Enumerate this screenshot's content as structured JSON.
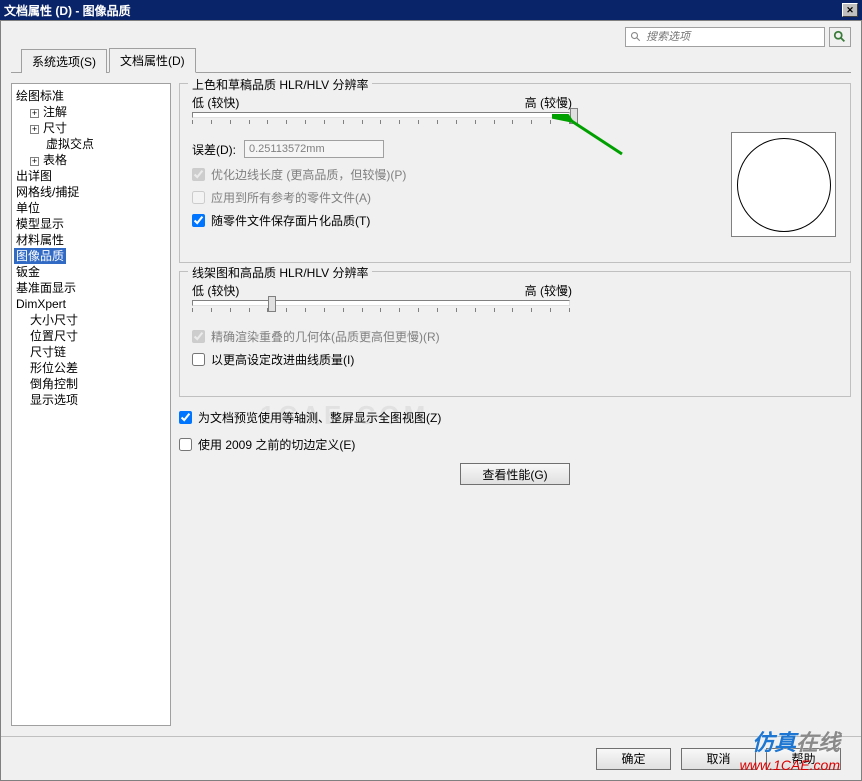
{
  "title": "文档属性 (D) - 图像品质",
  "search": {
    "placeholder": "搜索选项"
  },
  "tabs": {
    "system": "系统选项(S)",
    "document": "文档属性(D)"
  },
  "tree": {
    "root": "绘图标准",
    "annot": "注解",
    "dim": "尺寸",
    "virtual": "虚拟交点",
    "table": "表格",
    "detail": "出详图",
    "grid": "网格线/捕捉",
    "unit": "单位",
    "modeldisp": "模型显示",
    "material": "材料属性",
    "imagequality": "图像品质",
    "sheetmetal": "钣金",
    "datum": "基准面显示",
    "dimxpert": "DimXpert",
    "sizedim": "大小尺寸",
    "posdim": "位置尺寸",
    "chain": "尺寸链",
    "geotol": "形位公差",
    "chamfer": "倒角控制",
    "dispopt": "显示选项"
  },
  "group1": {
    "legend": "上色和草稿品质 HLR/HLV 分辨率",
    "low": "低 (较快)",
    "high": "高 (较慢)",
    "err_label": "误差(D):",
    "err_value": "0.25113572mm",
    "opt_edge": "优化边线长度 (更高品质，但较慢)(P)",
    "apply_all": "应用到所有参考的零件文件(A)",
    "save_tess": "随零件文件保存面片化品质(T)"
  },
  "group2": {
    "legend": "线架图和高品质 HLR/HLV 分辨率",
    "low": "低 (较快)",
    "high": "高 (较慢)",
    "precise": "精确渲染重叠的几何体(品质更高但更慢)(R)",
    "highcurve": "以更高设定改进曲线质量(I)"
  },
  "standalone": {
    "isometric": "为文档预览使用等轴测、整屏显示全图视图(Z)",
    "pre2009": "使用 2009 之前的切边定义(E)",
    "perf_btn": "查看性能(G)"
  },
  "footer": {
    "ok": "确定",
    "cancel": "取消",
    "help": "帮助"
  },
  "watermark": {
    "brand_a": "仿真",
    "brand_b": "在线",
    "url": "www.1CAE.com"
  },
  "wm2": "1CAE.COM"
}
